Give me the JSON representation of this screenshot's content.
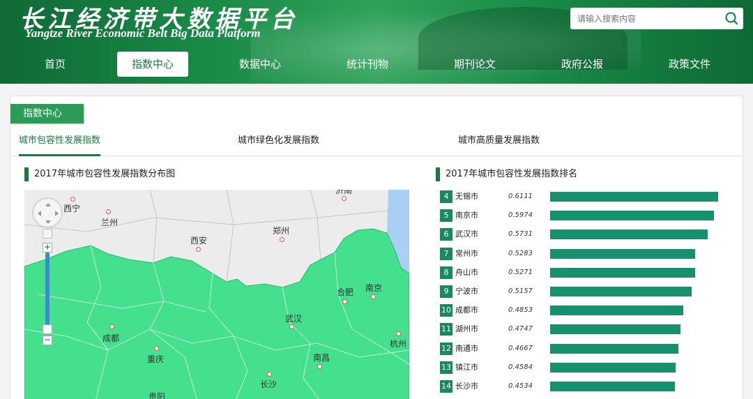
{
  "header": {
    "title_cn": "长江经济带大数据平台",
    "title_en": "Yangtze River Economic Belt Big Data Platform",
    "search_placeholder": "请输入搜索内容"
  },
  "nav": [
    {
      "label": "首页",
      "active": false
    },
    {
      "label": "指数中心",
      "active": true
    },
    {
      "label": "数据中心",
      "active": false
    },
    {
      "label": "统计刊物",
      "active": false
    },
    {
      "label": "期刊论文",
      "active": false
    },
    {
      "label": "政府公报",
      "active": false
    },
    {
      "label": "政策文件",
      "active": false
    }
  ],
  "section_title": "指数中心",
  "tabs": [
    {
      "label": "城市包容性发展指数",
      "active": true
    },
    {
      "label": "城市绿色化发展指数",
      "active": false
    },
    {
      "label": "城市高质量发展指数",
      "active": false
    }
  ],
  "map_title": "2017年城市包容性发展指数分布图",
  "map": {
    "cities": [
      {
        "name": "西宁"
      },
      {
        "name": "兰州"
      },
      {
        "name": "西安"
      },
      {
        "name": "郑州"
      },
      {
        "name": "济南"
      },
      {
        "name": "合肥"
      },
      {
        "name": "南京"
      },
      {
        "name": "武汉"
      },
      {
        "name": "成都"
      },
      {
        "name": "重庆"
      },
      {
        "name": "南昌"
      },
      {
        "name": "长沙"
      },
      {
        "name": "杭州"
      },
      {
        "name": "贵阳"
      }
    ],
    "zoom_in": "+",
    "zoom_out": "−",
    "colors": {
      "region": "#45e08e",
      "other": "#ececec",
      "sea": "#a9cff2"
    }
  },
  "rank_title": "2017年城市包容性发展指数排名",
  "chart_data": {
    "type": "bar",
    "title": "2017年城市包容性发展指数排名",
    "ranks": [
      "4",
      "5",
      "6",
      "7",
      "8",
      "9",
      "10",
      "11",
      "12",
      "13",
      "14"
    ],
    "categories": [
      "无锡市",
      "南京市",
      "武汉市",
      "常州市",
      "舟山市",
      "宁波市",
      "成都市",
      "湖州市",
      "南通市",
      "镇江市",
      "长沙市"
    ],
    "values": [
      0.6111,
      0.5974,
      0.5731,
      0.5283,
      0.5271,
      0.5157,
      0.4853,
      0.4747,
      0.4667,
      0.4584,
      0.4534
    ],
    "labels": [
      "0.6111",
      "0.5974",
      "0.5731",
      "0.5283",
      "0.5271",
      "0.5157",
      "0.4853",
      "0.4747",
      "0.4667",
      "0.4584",
      "0.4534"
    ],
    "xlim": [
      0,
      0.64
    ],
    "color": "#17906e"
  }
}
